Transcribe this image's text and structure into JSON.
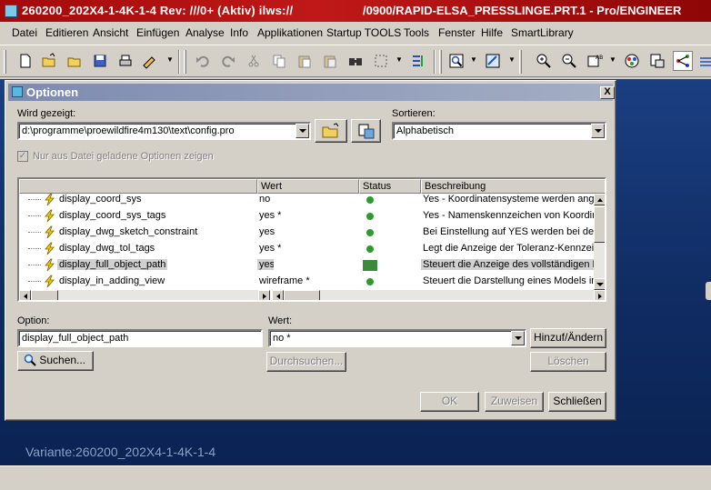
{
  "window": {
    "title_left": "260200_202X4-1-4K-1-4 Rev: ///0+ (Aktiv) ilws://",
    "title_right": "/0900/RAPID-ELSA_PRESSLINGE.PRT.1 - Pro/ENGINEER"
  },
  "menu": [
    "Datei",
    "Editieren",
    "Ansicht",
    "Einfügen",
    "Analyse",
    "Info",
    "Applikationen",
    "Startup TOOLS",
    "Tools",
    "Fenster",
    "Hilfe",
    "SmartLibrary"
  ],
  "graphics": {
    "variant": "Variante:260200_202X4-1-4K-1-4"
  },
  "dialog": {
    "title": "Optionen",
    "close": "X",
    "shown_label": "Wird gezeigt:",
    "shown_value": "d:\\programme\\proewildfire4m130\\text\\config.pro",
    "sort_label": "Sortieren:",
    "sort_value": "Alphabetisch",
    "only_file_label": "Nur aus Datei geladene Optionen zeigen",
    "only_file_checked": true,
    "columns": [
      "Wert",
      "Status",
      "Beschreibung"
    ],
    "rows": [
      {
        "name": "display_coord_sys",
        "value": "no",
        "desc": "Yes - Koordinatensysteme werden angez"
      },
      {
        "name": "display_coord_sys_tags",
        "value": "yes *",
        "desc": "Yes - Namenskennzeichen von Koordina"
      },
      {
        "name": "display_dwg_sketch_constraint",
        "value": "yes",
        "desc": "Bei Einstellung auf YES werden bei der A"
      },
      {
        "name": "display_dwg_tol_tags",
        "value": "yes *",
        "desc": "Legt die Anzeige der Toleranz-Kennzeicl"
      },
      {
        "name": "display_full_object_path",
        "value": "yes",
        "desc": "Steuert die Anzeige des vollständigen D"
      },
      {
        "name": "display_in_adding_view",
        "value": "wireframe *",
        "desc": "Steuert die Darstellung eines Models in e"
      }
    ],
    "option_label": "Option:",
    "option_value": "display_full_object_path",
    "wert_label": "Wert:",
    "wert_value": "no *",
    "add_change": "Hinzuf/Ändern",
    "search": "Suchen...",
    "browse": "Durchsuchen...",
    "delete": "Löschen",
    "ok": "OK",
    "apply": "Zuweisen",
    "close_btn": "Schließen"
  },
  "colors": {
    "titlebar": "#b01010",
    "graphics_bg": "#102c63",
    "dialog_bg": "#d4d0c8"
  }
}
